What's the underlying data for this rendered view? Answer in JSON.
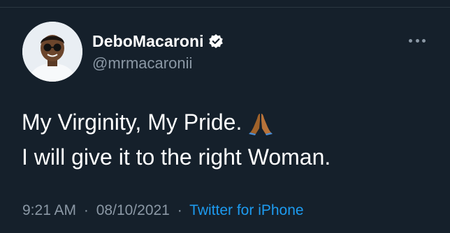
{
  "tweet": {
    "author": {
      "display_name": "DeboMacaroni",
      "handle": "@mrmacaronii",
      "verified": true,
      "avatar_icon": "profile-photo"
    },
    "text_lines": [
      "My Virginity, My Pride.",
      "I will give it to the right Woman."
    ],
    "emoji": "folded-hands",
    "time": "9:21 AM",
    "date": "08/10/2021",
    "source": "Twitter for iPhone",
    "separator": "·"
  },
  "colors": {
    "background": "#15202b",
    "primary_text": "#ffffff",
    "secondary_text": "#8b98a5",
    "link": "#1d9bf0"
  },
  "icons": {
    "verified": "verified-badge-icon",
    "more": "more-options-icon"
  }
}
